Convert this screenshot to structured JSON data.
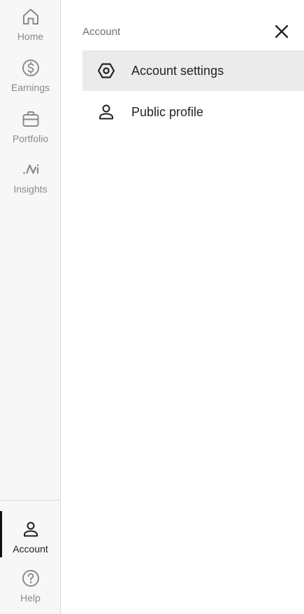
{
  "rail": {
    "items": [
      {
        "label": "Home",
        "icon": "home-icon"
      },
      {
        "label": "Earnings",
        "icon": "dollar-circle-icon"
      },
      {
        "label": "Portfolio",
        "icon": "briefcase-icon"
      },
      {
        "label": "Insights",
        "icon": "insights-icon"
      }
    ],
    "bottom": [
      {
        "label": "Account",
        "icon": "person-icon",
        "active": true
      },
      {
        "label": "Help",
        "icon": "help-circle-icon"
      }
    ]
  },
  "panel": {
    "title": "Account",
    "items": [
      {
        "label": "Account settings",
        "icon": "settings-hexagon-icon",
        "selected": true
      },
      {
        "label": "Public profile",
        "icon": "person-icon"
      }
    ]
  },
  "colors": {
    "rail_bg": "#f7f7f7",
    "selected_bg": "#ebebeb",
    "active_indicator": "#111111",
    "muted_text": "#8a8a8a"
  }
}
